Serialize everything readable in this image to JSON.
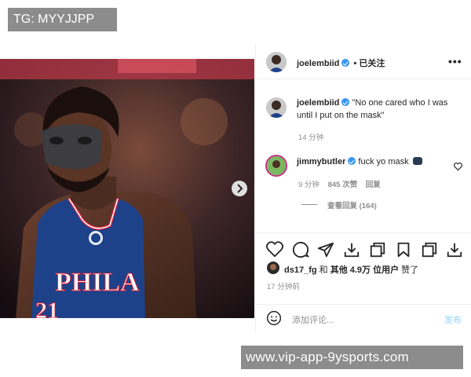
{
  "watermark_top": "TG: MYYJJPP",
  "watermark_bottom": "www.vip-app-9ysports.com",
  "header": {
    "username": "joelembiid",
    "follow_status": "• 已关注",
    "more": "•••"
  },
  "caption": {
    "username": "joelembiid",
    "text_line1": "\"No one cared who I was",
    "text_line2": "until I put on the mask\"",
    "time": "14 分钟"
  },
  "comment": {
    "username": "jimmybutler",
    "text": "fuck yo mask",
    "time": "9 分钟",
    "likes": "845 次赞",
    "reply": "回复",
    "view_replies": "查看回复 (164)"
  },
  "likes": {
    "user": "ds17_fg",
    "conj": "和",
    "others": "其他 4.9万 位用户",
    "verb": "赞了"
  },
  "post_time": "17 分钟前",
  "add_comment": {
    "placeholder": "添加评论...",
    "post_label": "发布"
  },
  "photo": {
    "jersey_text": "PHILA",
    "jersey_number": "21"
  },
  "icons": [
    "heart-icon",
    "comment-icon",
    "share-icon",
    "download-icon",
    "copy-icon",
    "bookmark-icon",
    "copy-icon",
    "download-icon"
  ],
  "colors": {
    "accent": "#3897f0",
    "watermark_bg": "#8c8c8c",
    "jersey": "#1d428a"
  }
}
